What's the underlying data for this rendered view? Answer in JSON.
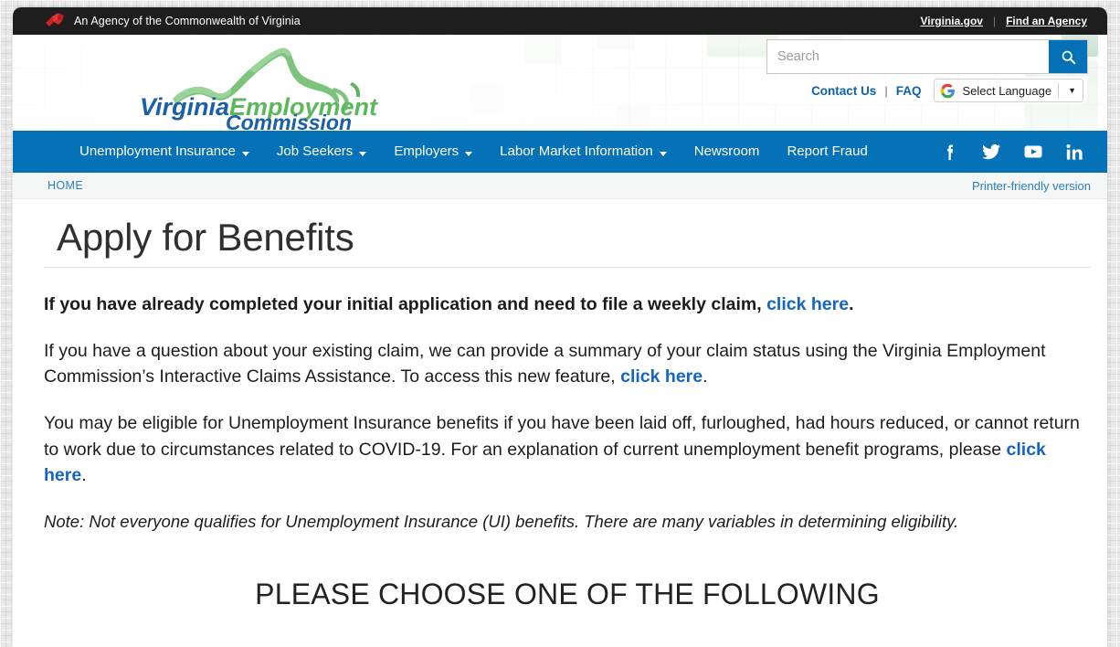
{
  "gov_bar": {
    "agency_text": "An Agency of the Commonwealth of Virginia",
    "icon": "virginia-agency-mark",
    "links": [
      {
        "label": "Virginia.gov",
        "name": "virginia-gov-link"
      },
      {
        "label": "Find an Agency",
        "name": "find-an-agency-link"
      }
    ],
    "separator": "|"
  },
  "masthead": {
    "logo": {
      "line1_a": "Virginia",
      "line1_b": "Employment",
      "line2": "Commission",
      "alt": "Virginia Employment Commission",
      "blue": "#1a5fa8",
      "green": "#5cb85c"
    },
    "search": {
      "placeholder": "Search",
      "value": "",
      "button_icon": "search-icon",
      "button_color": "#0571b6"
    },
    "utility": {
      "contact_label": "Contact Us",
      "separator": "|",
      "faq_label": "FAQ",
      "language_label": "Select Language",
      "language_icon": "google-g-icon",
      "language_caret": "▼"
    }
  },
  "nav": {
    "background": "#0571b6",
    "items": [
      {
        "label": "Unemployment Insurance",
        "has_caret": true,
        "name": "nav-unemployment-insurance"
      },
      {
        "label": "Job Seekers",
        "has_caret": true,
        "name": "nav-job-seekers"
      },
      {
        "label": "Employers",
        "has_caret": true,
        "name": "nav-employers"
      },
      {
        "label": "Labor Market Information",
        "has_caret": true,
        "name": "nav-labor-market-information"
      },
      {
        "label": "Newsroom",
        "has_caret": false,
        "name": "nav-newsroom"
      },
      {
        "label": "Report Fraud",
        "has_caret": false,
        "name": "nav-report-fraud"
      }
    ],
    "social": [
      {
        "name": "facebook-icon",
        "title": "Facebook"
      },
      {
        "name": "twitter-icon",
        "title": "Twitter"
      },
      {
        "name": "youtube-icon",
        "title": "YouTube"
      },
      {
        "name": "linkedin-icon",
        "title": "LinkedIn"
      }
    ]
  },
  "breadcrumb": {
    "home_label": "HOME",
    "printer_label": "Printer-friendly version"
  },
  "main": {
    "title": "Apply for Benefits",
    "paragraphs": [
      {
        "style": "bold",
        "pre": "If you have already completed your initial application and need to file a weekly claim, ",
        "link": "click here",
        "post": "."
      },
      {
        "style": "normal",
        "pre": "If you have a question about your existing claim, we can provide a summary of your claim status using the Virginia Employment Commission’s Interactive Claims Assistance. To access this new feature, ",
        "link": "click here",
        "link_bold": true,
        "post": "."
      },
      {
        "style": "normal",
        "pre": "You may be eligible for Unemployment Insurance benefits if you have been laid off, furloughed, had hours reduced, or cannot return to work due to circumstances related to COVID-19. For an explanation of current unemployment benefit programs, please ",
        "link": "click here",
        "link_bold": true,
        "post": "."
      }
    ],
    "note": "Note: Not everyone qualifies for Unemployment Insurance (UI) benefits. There are many variables in determining eligibility.",
    "choose_heading": "PLEASE CHOOSE ONE OF THE FOLLOWING"
  }
}
